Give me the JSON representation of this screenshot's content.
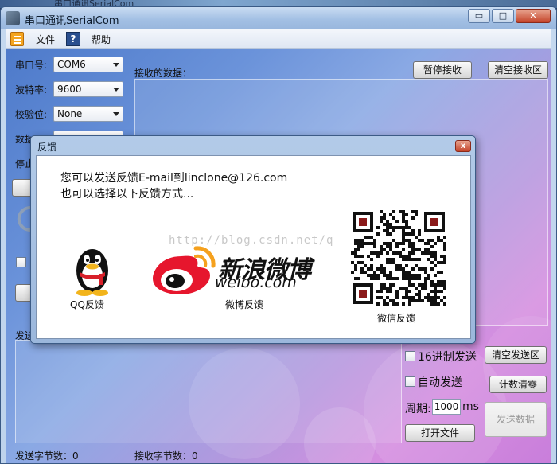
{
  "background": {
    "tab_title": "串口通讯SerialCom",
    "tab_title_prefix": "≡"
  },
  "window": {
    "title": "串口通讯SerialCom",
    "controls": {
      "minimize": "▭",
      "maximize": "□",
      "close": "✕"
    }
  },
  "menu": {
    "file": "文件",
    "help_icon_text": "?",
    "help": "帮助"
  },
  "settings": {
    "port_label": "串口号:",
    "port_value": "COM6",
    "baud_label": "波特率:",
    "baud_value": "9600",
    "parity_label": "校验位:",
    "parity_value": "None",
    "databits_label_partial": "数据",
    "stopbits_label_partial": "停止"
  },
  "receive": {
    "label": "接收的数据：",
    "pause_button": "暂停接收",
    "clear_button": "清空接收区"
  },
  "send": {
    "label_partial": "发送",
    "hex_label": "16进制发送",
    "clear_button": "清空发送区",
    "auto_label": "自动发送",
    "count_clear_button": "计数清零",
    "period_label": "周期:",
    "period_value": "1000",
    "period_unit": "ms",
    "open_file_button": "打开文件",
    "send_button": "发送数据"
  },
  "status": {
    "sent_label": "发送字节数：0",
    "received_label": "接收字节数：0"
  },
  "feedback_dialog": {
    "title": "反馈",
    "close": "x",
    "line1": "您可以发送反馈E-mail到linclone@126.com",
    "line2": "也可以选择以下反馈方式...",
    "watermark": "http://blog.csdn.net/q",
    "qq_label": "QQ反馈",
    "weibo_logo_cn": "新浪微博",
    "weibo_logo_en": "weibo.com",
    "weibo_label": "微博反馈",
    "wechat_label": "微信反馈"
  },
  "colors": {
    "accent_close": "#c4442a",
    "weibo_red": "#e6162d",
    "weibo_orange": "#f5a11e",
    "qq_black": "#111111",
    "qq_yellow": "#f2b41c"
  }
}
